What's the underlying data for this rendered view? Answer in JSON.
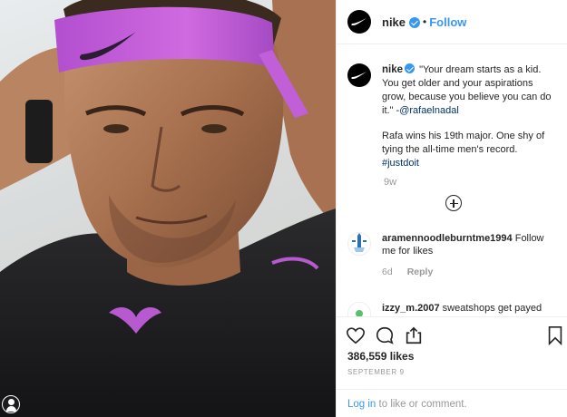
{
  "post": {
    "username": "nike",
    "header_dot": "•",
    "follow_label": "Follow",
    "caption": {
      "quote": "\"Your dream starts as a kid. You get older and your aspirations grow, because you believe you can do it.\" -",
      "mention": "@rafaelnadal",
      "body": "Rafa wins his 19th major. One shy of tying the all-time men's record.",
      "hashtag": "#justdoit",
      "time": "9w"
    },
    "comments": [
      {
        "username": "aramennoodleburntme1994",
        "text": "Follow me for likes",
        "time": "6d",
        "reply_label": "Reply"
      },
      {
        "username": "izzy_m.2007",
        "text": "sweatshops get payed"
      }
    ],
    "likes": "386,559 likes",
    "date": "SEPTEMBER 9",
    "login_link": "Log in",
    "login_rest": " to like or comment."
  },
  "icons": {
    "brand_logo": "nike-swoosh-icon",
    "verified": "verified-badge-icon",
    "load_more": "plus-circle-icon",
    "like": "heart-icon",
    "comment": "comment-bubble-icon",
    "share": "share-icon",
    "save": "bookmark-icon"
  },
  "colors": {
    "accent": "#3897f0",
    "headband": "#c35ed8",
    "text": "#262626",
    "muted": "#999999"
  }
}
